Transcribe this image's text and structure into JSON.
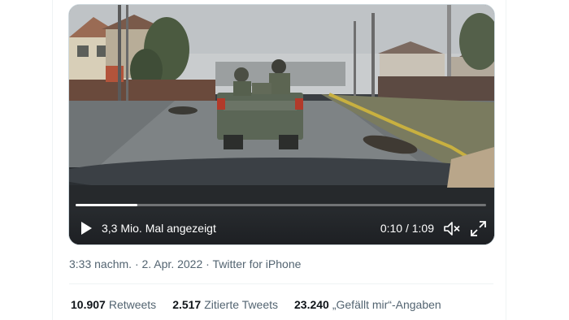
{
  "video": {
    "views": "3,3 Mio. Mal angezeigt",
    "time": "0:10 / 1:09",
    "progress_fraction": 0.15,
    "icons": {
      "play": "play-icon",
      "volume": "volume-icon",
      "fullscreen": "fullscreen-icon"
    }
  },
  "tweet_meta": {
    "time": "3:33 nachm.",
    "sep1": " · ",
    "date": "2. Apr. 2022",
    "sep2": " · ",
    "source": "Twitter for iPhone"
  },
  "stats": [
    {
      "count": "10.907",
      "label": "Retweets"
    },
    {
      "count": "2.517",
      "label": "Zitierte Tweets"
    },
    {
      "count": "23.240",
      "label": "„Gefällt mir“-Angaben"
    }
  ],
  "colors": {
    "text_primary": "#0f1419",
    "text_secondary": "#536471",
    "border": "#cfd9de"
  }
}
